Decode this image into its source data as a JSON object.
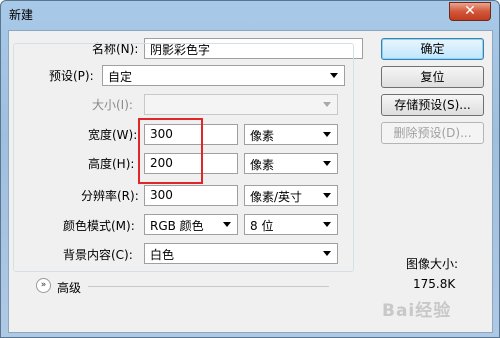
{
  "window": {
    "title": "新建",
    "close_glyph": "✕"
  },
  "form": {
    "name_label": "名称(N):",
    "name_value": "阴影彩色字",
    "preset_label": "预设(P):",
    "preset_value": "自定",
    "size_label": "大小(I):",
    "size_value": "",
    "width_label": "宽度(W):",
    "width_value": "300",
    "width_unit": "像素",
    "height_label": "高度(H):",
    "height_value": "200",
    "height_unit": "像素",
    "resolution_label": "分辨率(R):",
    "resolution_value": "300",
    "resolution_unit": "像素/英寸",
    "colormode_label": "颜色模式(M):",
    "colormode_value": "RGB 颜色",
    "bitdepth_value": "8 位",
    "background_label": "背景内容(C):",
    "background_value": "白色",
    "advanced_label": "高级",
    "advanced_icon": "»"
  },
  "buttons": {
    "ok": "确定",
    "reset": "复位",
    "save_preset": "存储预设(S)...",
    "delete_preset": "删除预设(D)..."
  },
  "info": {
    "image_size_caption": "图像大小:",
    "image_size_value": "175.8K"
  },
  "watermark": "Bai经验",
  "colors": {
    "highlight": "#e0262b",
    "default_button": "#3c7fb1"
  }
}
